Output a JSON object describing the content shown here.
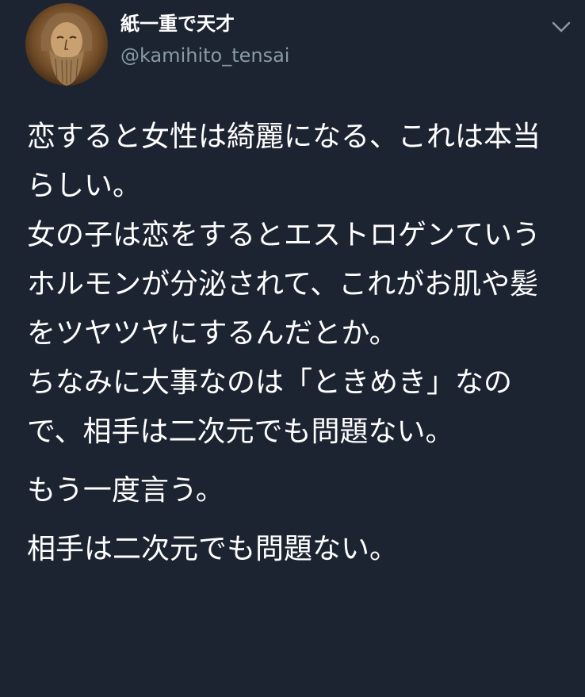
{
  "user": {
    "display_name": "紙一重で天才",
    "handle": "@kamihito_tensai"
  },
  "icons": {
    "menu": "chevron-down-icon",
    "avatar": "avatar"
  },
  "colors": {
    "background": "#1c2431",
    "handle": "#8899a6",
    "text": "#ffffff"
  },
  "tweet": {
    "paragraph_1": "恋すると女性は綺麗になる、これは本当らしい。\n女の子は恋をするとエストロゲンていうホルモンが分泌されて、これがお肌や髪をツヤツヤにするんだとか。\nちなみに大事なのは「ときめき」なので、相手は二次元でも問題ない。",
    "paragraph_2": "もう一度言う。",
    "paragraph_3": "相手は二次元でも問題ない。"
  }
}
